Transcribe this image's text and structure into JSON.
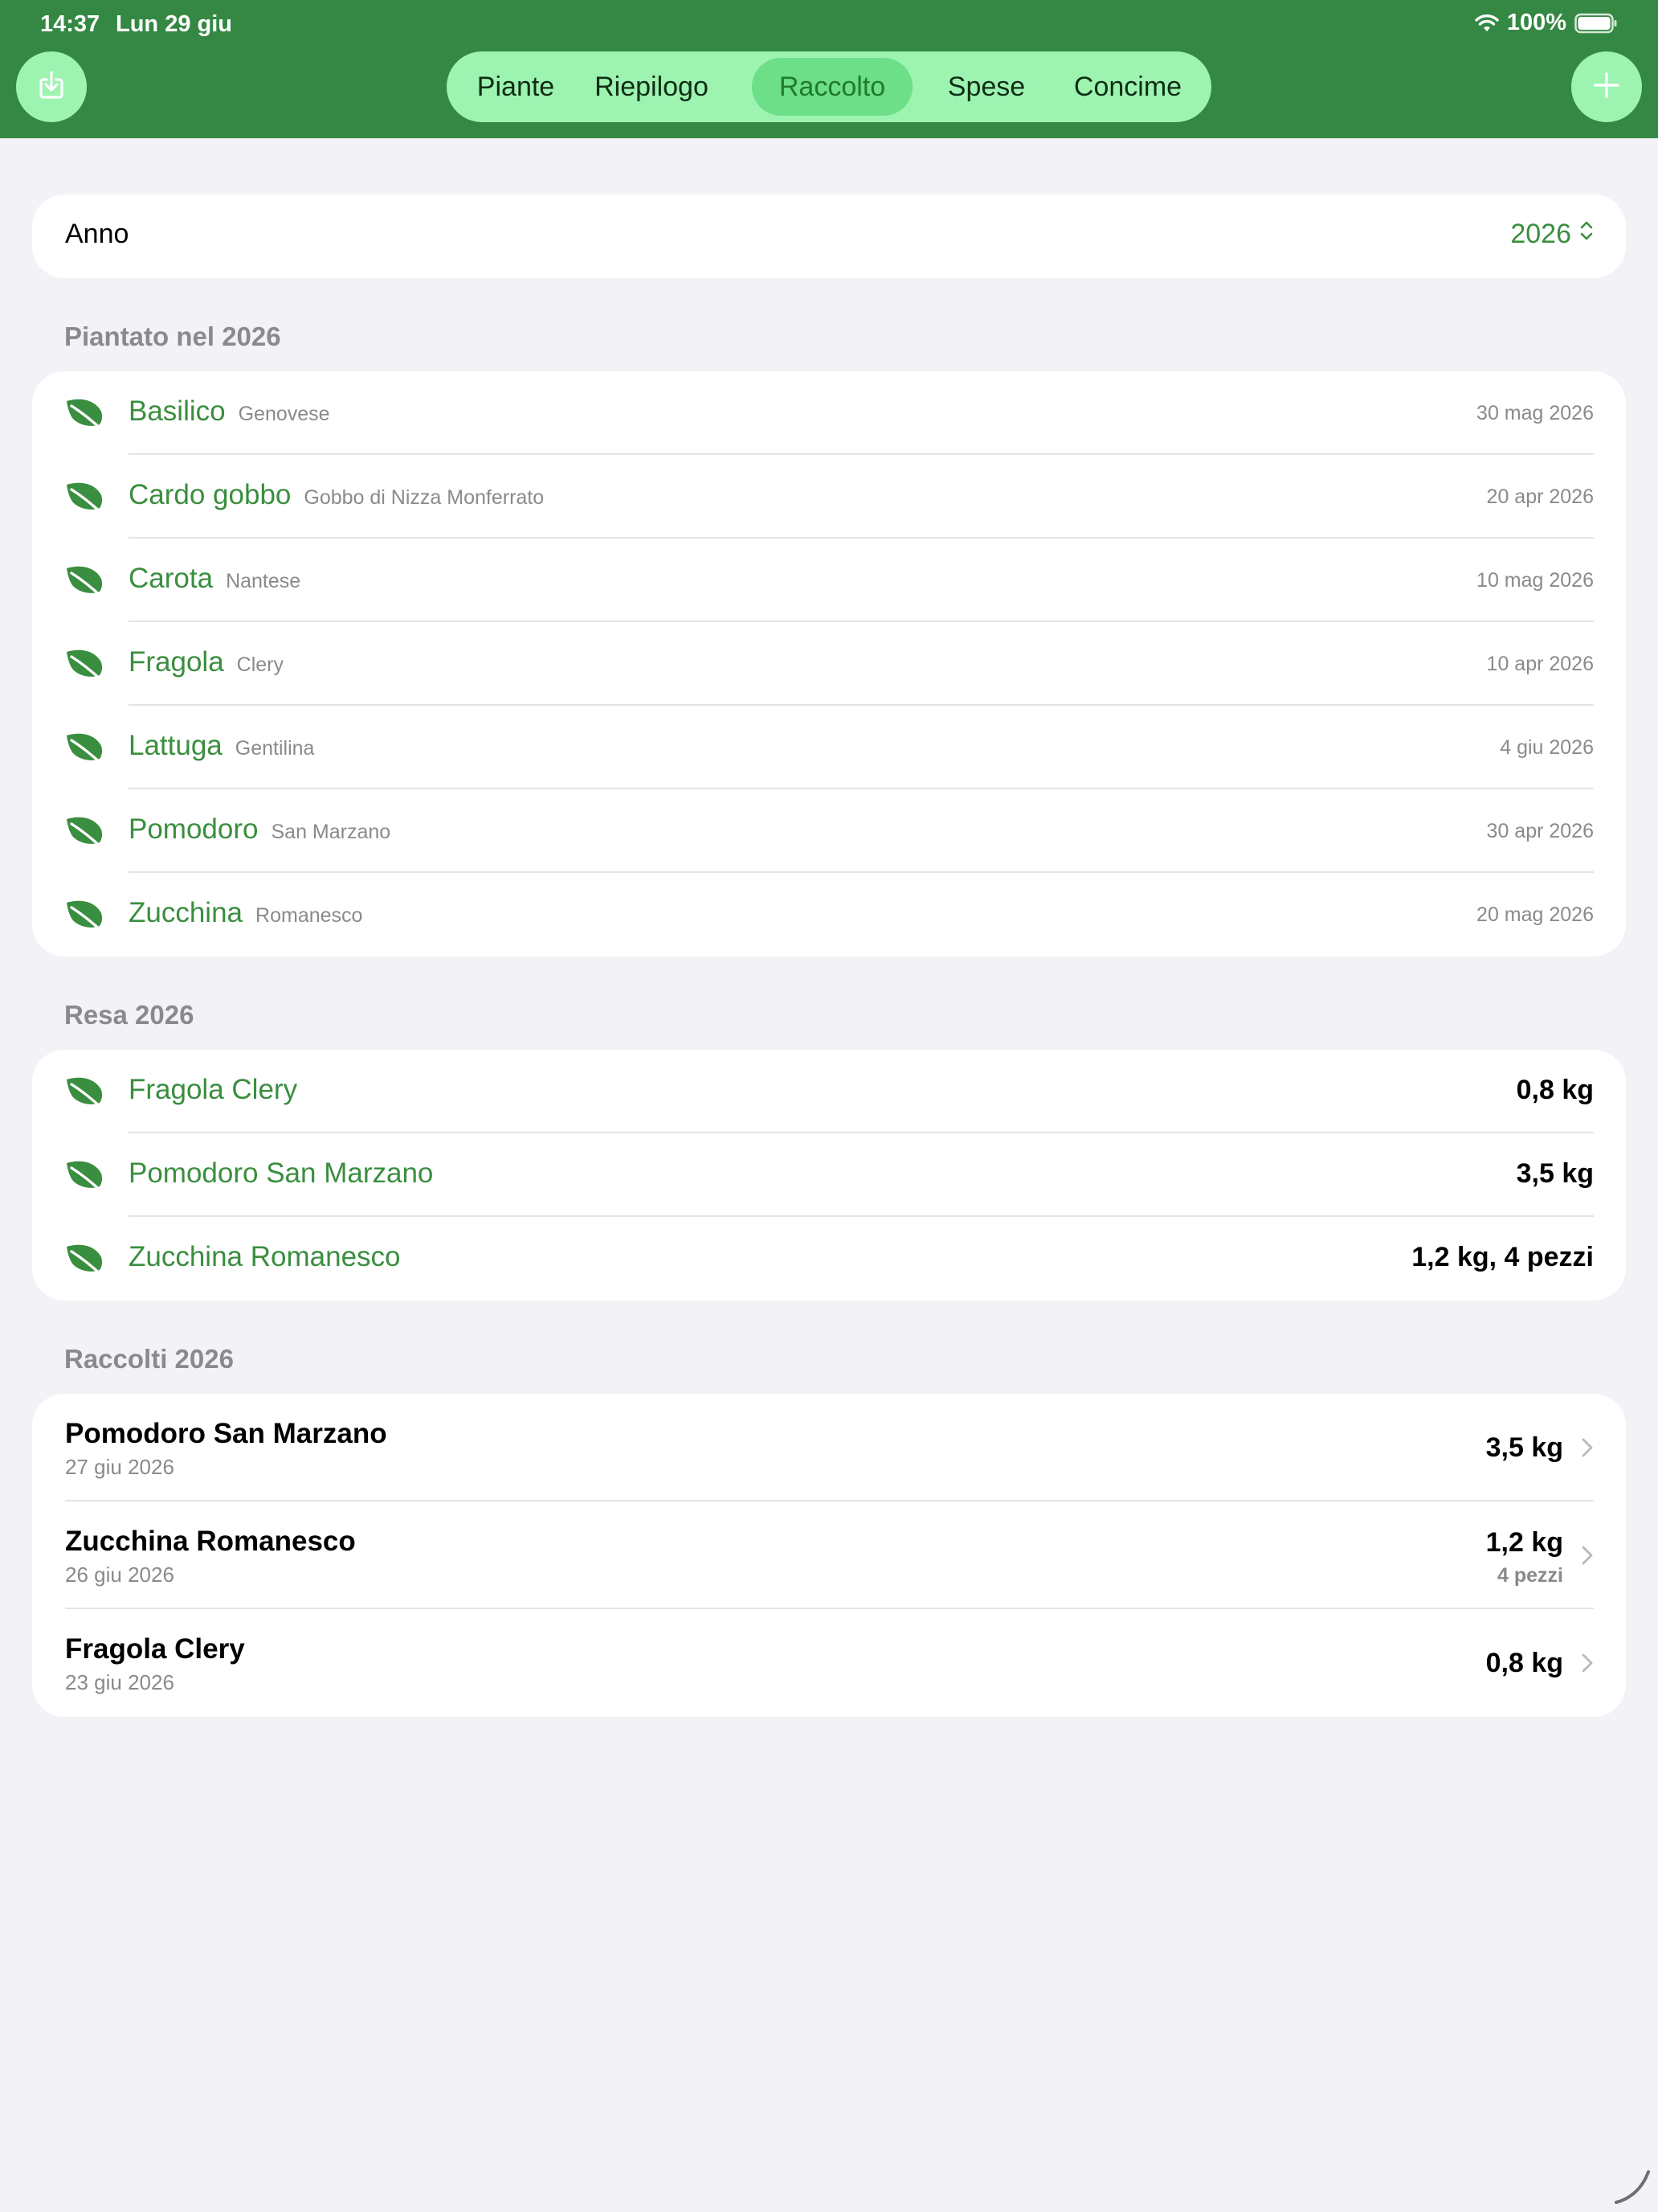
{
  "status_bar": {
    "time": "14:37",
    "date": "Lun 29 giu",
    "battery": "100%"
  },
  "toolbar": {
    "import_icon": "tray-arrow-down-icon",
    "add_icon": "plus-icon",
    "tabs": [
      {
        "label": "Piante",
        "selected": false
      },
      {
        "label": "Riepilogo",
        "selected": false
      },
      {
        "label": "Raccolto",
        "selected": true
      },
      {
        "label": "Spese",
        "selected": false
      },
      {
        "label": "Concime",
        "selected": false
      }
    ]
  },
  "year_picker": {
    "label": "Anno",
    "value": "2026"
  },
  "planted": {
    "title": "Piantato nel 2026",
    "items": [
      {
        "name": "Basilico",
        "variety": "Genovese",
        "date": "30 mag 2026"
      },
      {
        "name": "Cardo gobbo",
        "variety": "Gobbo di Nizza Monferrato",
        "date": "20 apr 2026"
      },
      {
        "name": "Carota",
        "variety": "Nantese",
        "date": "10 mag 2026"
      },
      {
        "name": "Fragola",
        "variety": "Clery",
        "date": "10 apr 2026"
      },
      {
        "name": "Lattuga",
        "variety": "Gentilina",
        "date": "4 giu 2026"
      },
      {
        "name": "Pomodoro",
        "variety": "San Marzano",
        "date": "30 apr 2026"
      },
      {
        "name": "Zucchina",
        "variety": "Romanesco",
        "date": "20 mag 2026"
      }
    ]
  },
  "yield": {
    "title": "Resa 2026",
    "items": [
      {
        "name": "Fragola Clery",
        "value": "0,8 kg"
      },
      {
        "name": "Pomodoro San Marzano",
        "value": "3,5 kg"
      },
      {
        "name": "Zucchina Romanesco",
        "value": "1,2 kg, 4 pezzi"
      }
    ]
  },
  "harvests": {
    "title": "Raccolti 2026",
    "items": [
      {
        "name": "Pomodoro San Marzano",
        "date": "27 giu 2026",
        "value": "3,5 kg",
        "sub": ""
      },
      {
        "name": "Zucchina Romanesco",
        "date": "26 giu 2026",
        "value": "1,2 kg",
        "sub": "4 pezzi"
      },
      {
        "name": "Fragola Clery",
        "date": "23 giu 2026",
        "value": "0,8 kg",
        "sub": ""
      }
    ]
  },
  "colors": {
    "header_green": "#348843",
    "mint": "#9df3b0",
    "accent_green": "#3a8e3f"
  }
}
